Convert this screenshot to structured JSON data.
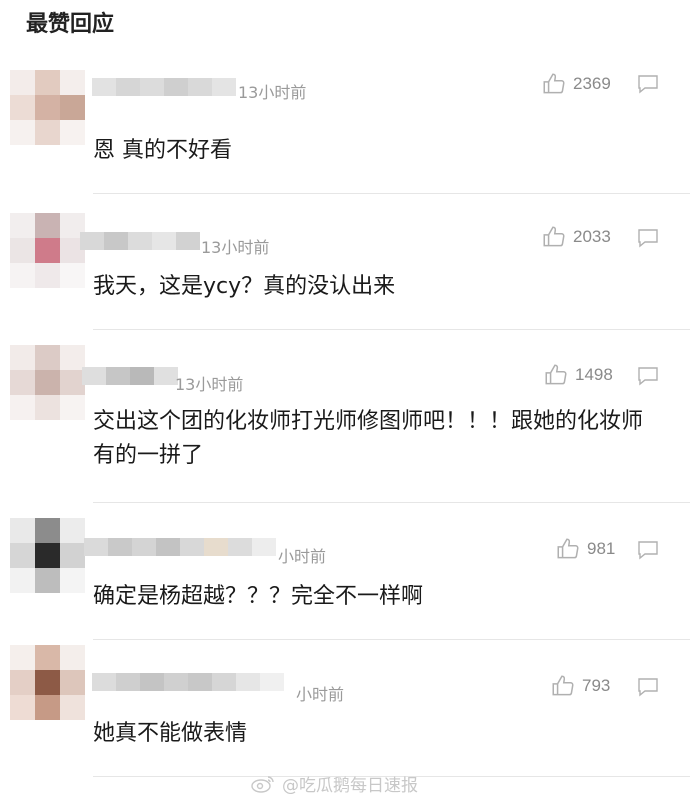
{
  "header": {
    "title": "最赞回应"
  },
  "comments": [
    {
      "time": "13小时前",
      "likes": "2369",
      "text": "恩 真的不好看"
    },
    {
      "time": "13小时前",
      "likes": "2033",
      "text": "我天，这是ycy？真的没认出来"
    },
    {
      "time": "13小时前",
      "likes": "1498",
      "text": "交出这个团的化妆师打光师修图师吧！！！跟她的化妆师有的一拼了"
    },
    {
      "time": "小时前",
      "likes": "981",
      "text": "确定是杨超越？？？完全不一样啊"
    },
    {
      "time": "小时前",
      "likes": "793",
      "text": "她真不能做表情"
    }
  ],
  "watermark": {
    "text": "@吃瓜鹅每日速报"
  },
  "colors": {
    "divider": "#e6e6e6",
    "meta_text": "#9a9a9a",
    "icon": "#b0b0b0"
  }
}
